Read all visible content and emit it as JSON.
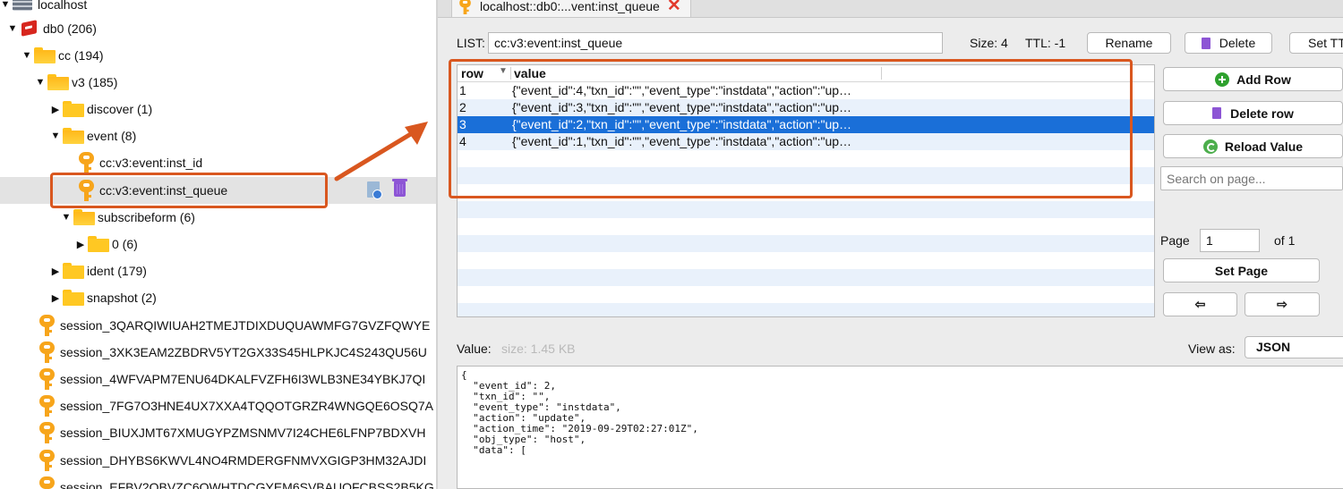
{
  "tree": {
    "server": "localhost",
    "db": "db0 (206)",
    "cc": "cc (194)",
    "v3": "v3 (185)",
    "discover": "discover (1)",
    "event": "event (8)",
    "key_inst_id": "cc:v3:event:inst_id",
    "key_inst_queue": "cc:v3:event:inst_queue",
    "subscribeform": "subscribeform (6)",
    "zero": "0 (6)",
    "ident": "ident (179)",
    "snapshot": "snapshot (2)",
    "sessions": [
      "session_3QARQIWIUAH2TMEJTDIXDUQUAWMFG7GVZFQWYE",
      "session_3XK3EAM2ZBDRV5YT2GX33S45HLPKJC4S243QU56U",
      "session_4WFVAPM7ENU64DKALFVZFH6I3WLB3NE34YBKJ7QI",
      "session_7FG7O3HNE4UX7XXA4TQQOTGRZR4WNGQE6OSQ7A",
      "session_BIUXJMT67XMUGYPZMSNMV7I24CHE6LFNP7BDXVH",
      "session_DHYBS6KWVL4NO4RMDERGFNMVXGIGP3HM32AJDI",
      "session_EFBV2QBVZC6QWHTDCGYEM6SVBAUQFCBSS2B5KG"
    ]
  },
  "tab": {
    "label": "localhost::db0:...vent:inst_queue"
  },
  "toolbar": {
    "list_label": "LIST:",
    "key_value": "cc:v3:event:inst_queue",
    "size": "Size: 4",
    "ttl": "TTL: -1",
    "rename": "Rename",
    "delete": "Delete",
    "set_ttl": "Set TT"
  },
  "table": {
    "headers": {
      "row": "row",
      "value": "value"
    },
    "rows": [
      {
        "n": "1",
        "v": "{\"event_id\":4,\"txn_id\":\"\",\"event_type\":\"instdata\",\"action\":\"up…"
      },
      {
        "n": "2",
        "v": "{\"event_id\":3,\"txn_id\":\"\",\"event_type\":\"instdata\",\"action\":\"up…"
      },
      {
        "n": "3",
        "v": "{\"event_id\":2,\"txn_id\":\"\",\"event_type\":\"instdata\",\"action\":\"up…"
      },
      {
        "n": "4",
        "v": "{\"event_id\":1,\"txn_id\":\"\",\"event_type\":\"instdata\",\"action\":\"up…"
      }
    ],
    "selected_index": 2
  },
  "side": {
    "add_row": "Add Row",
    "delete_row": "Delete row",
    "reload_value": "Reload Value",
    "search_placeholder": "Search on page...",
    "page_label": "Page",
    "page_value": "1",
    "of_pages": "of 1",
    "set_page": "Set Page",
    "prev": "⇦",
    "next": "⇨"
  },
  "value_pane": {
    "label": "Value:",
    "size": "size: 1.45 KB",
    "view_as_label": "View as:",
    "view_as_value": "JSON",
    "json_text": "{\n  \"event_id\": 2,\n  \"txn_id\": \"\",\n  \"event_type\": \"instdata\",\n  \"action\": \"update\",\n  \"action_time\": \"2019-09-29T02:27:01Z\",\n  \"obj_type\": \"host\",\n  \"data\": ["
  },
  "colors": {
    "highlight": "#d9571f",
    "selection": "#1a6fd8",
    "folder": "#ffc823",
    "key": "#f7a51b"
  },
  "icons": [
    "server-icon",
    "redis-db-icon",
    "folder-icon",
    "key-icon",
    "trash-icon",
    "copy-icon",
    "close-icon",
    "plus-icon",
    "reload-icon",
    "arrow-left-icon",
    "arrow-right-icon",
    "sort-icon"
  ]
}
